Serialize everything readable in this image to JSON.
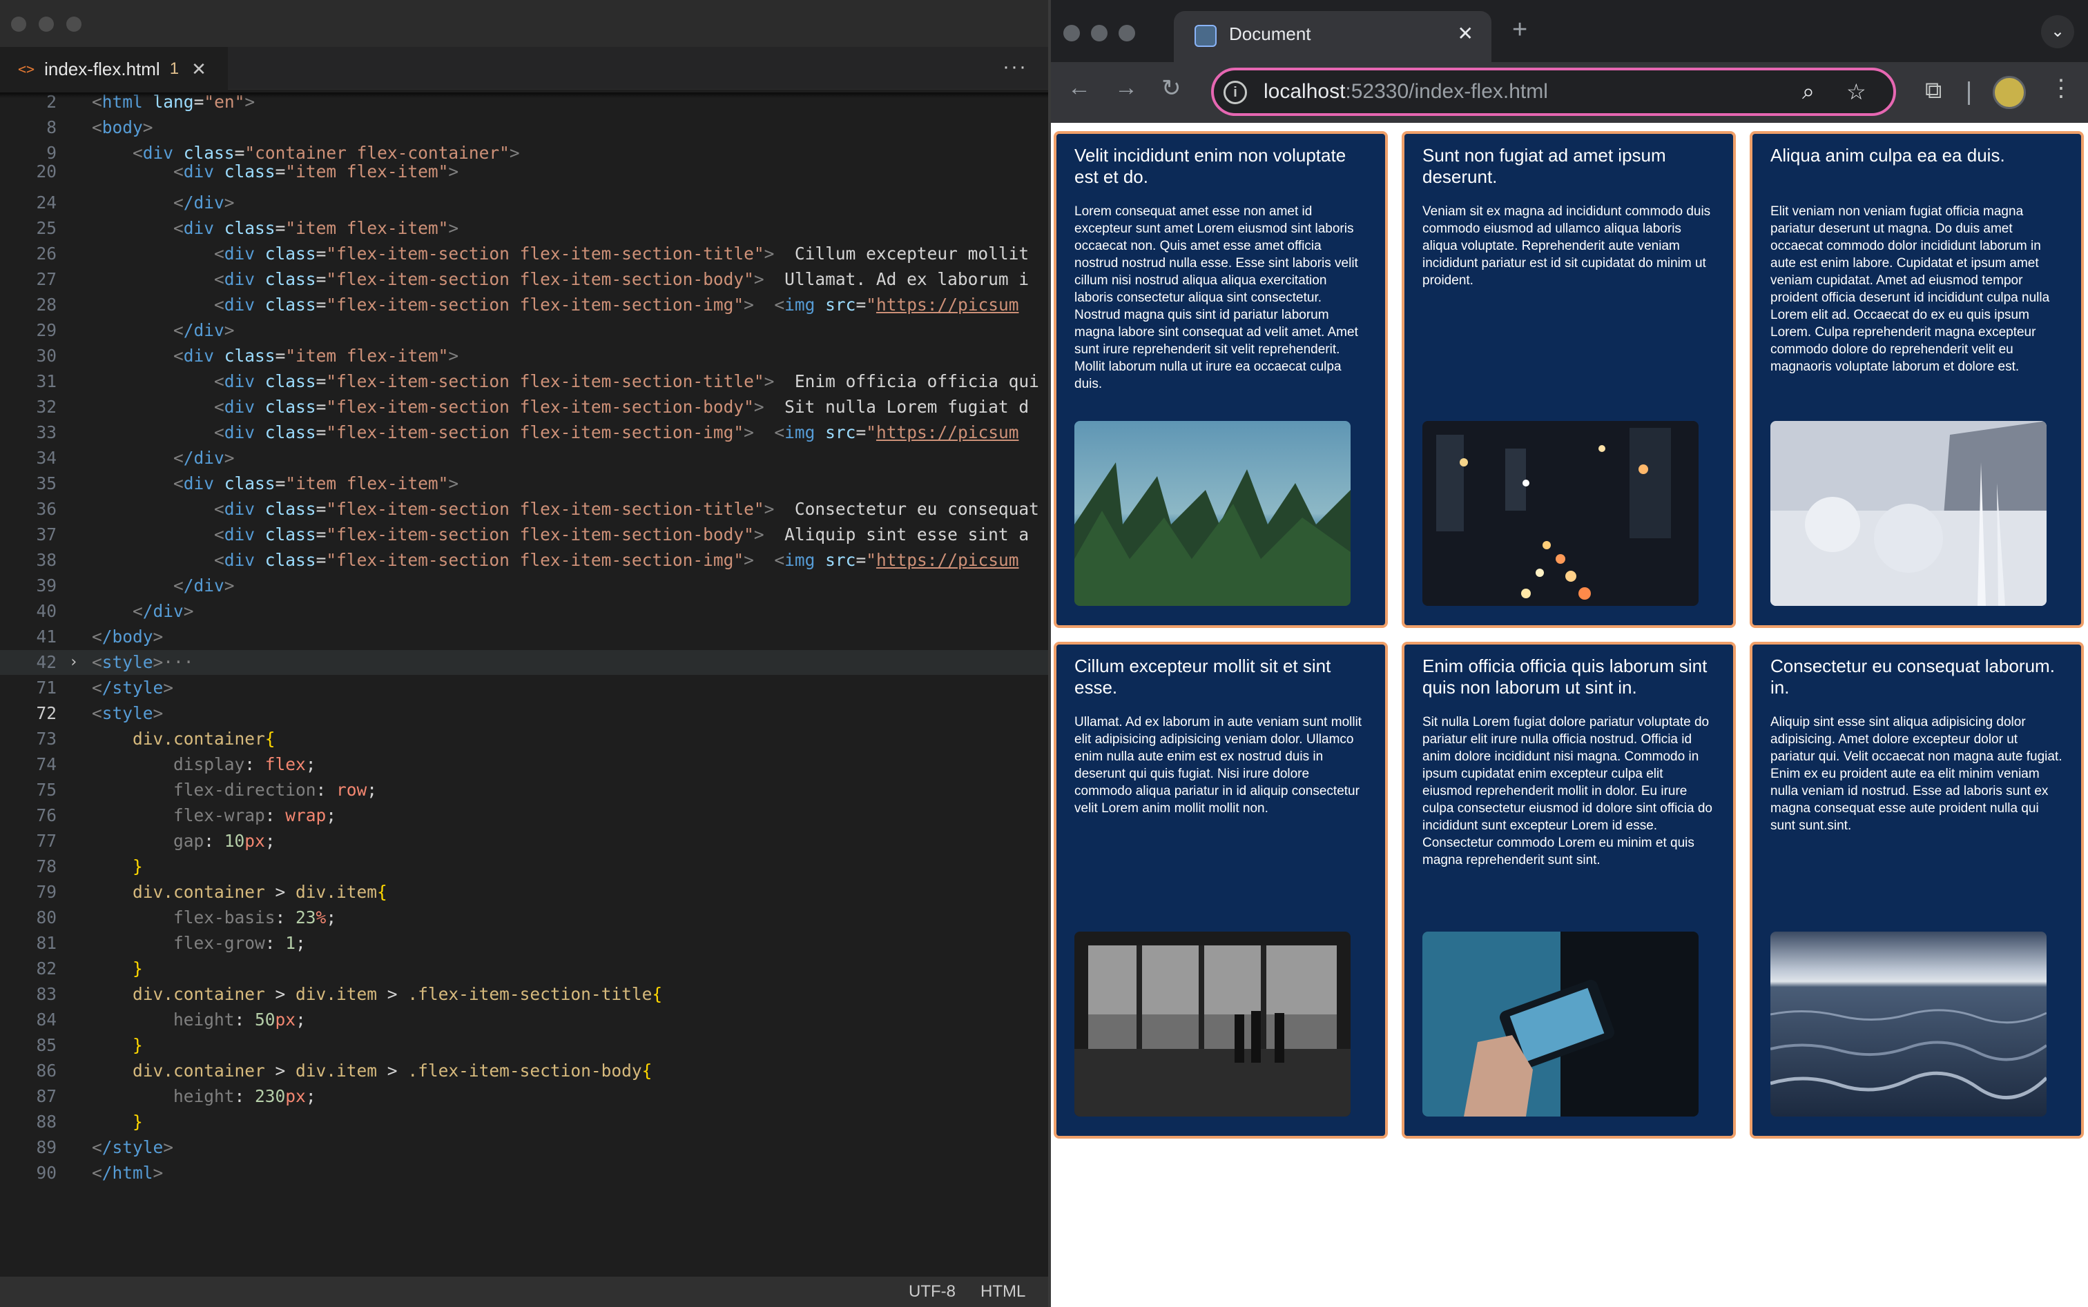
{
  "editor": {
    "tab": {
      "filename": "index-flex.html",
      "badge": "1"
    },
    "more_icon": "ellipsis-icon",
    "status": {
      "encoding": "UTF-8",
      "language": "HTML"
    },
    "lines": [
      {
        "n": "2",
        "text": "<html lang=\"en\">"
      },
      {
        "n": "8",
        "text": "<body>"
      },
      {
        "n": "9",
        "text": "<div class=\"container flex-container\">"
      },
      {
        "n": "20",
        "text": "<div class=\"item flex-item\">"
      },
      {
        "n": "24",
        "text": "</div>"
      },
      {
        "n": "25",
        "text": "<div class=\"item flex-item\">"
      },
      {
        "n": "26",
        "text": "<div class=\"flex-item-section flex-item-section-title\">  Cillum excepteur mollit"
      },
      {
        "n": "27",
        "text": "<div class=\"flex-item-section flex-item-section-body\">  Ullamat. Ad ex laborum i"
      },
      {
        "n": "28",
        "text": "<div class=\"flex-item-section flex-item-section-img\">  <img src=\"https://picsum"
      },
      {
        "n": "29",
        "text": "</div>"
      },
      {
        "n": "30",
        "text": "<div class=\"item flex-item\">"
      },
      {
        "n": "31",
        "text": "<div class=\"flex-item-section flex-item-section-title\">  Enim officia officia qui"
      },
      {
        "n": "32",
        "text": "<div class=\"flex-item-section flex-item-section-body\">  Sit nulla Lorem fugiat d"
      },
      {
        "n": "33",
        "text": "<div class=\"flex-item-section flex-item-section-img\">  <img src=\"https://picsum"
      },
      {
        "n": "34",
        "text": "</div>"
      },
      {
        "n": "35",
        "text": "<div class=\"item flex-item\">"
      },
      {
        "n": "36",
        "text": "<div class=\"flex-item-section flex-item-section-title\">  Consectetur eu consequat"
      },
      {
        "n": "37",
        "text": "<div class=\"flex-item-section flex-item-section-body\">  Aliquip sint esse sint a"
      },
      {
        "n": "38",
        "text": "<div class=\"flex-item-section flex-item-section-img\">  <img src=\"https://picsum"
      },
      {
        "n": "39",
        "text": "</div>"
      },
      {
        "n": "40",
        "text": "</div>"
      },
      {
        "n": "41",
        "text": "</body>"
      },
      {
        "n": "42",
        "text": "<style>···"
      },
      {
        "n": "71",
        "text": "</style>"
      },
      {
        "n": "72",
        "text": "<style>"
      },
      {
        "n": "73",
        "text": "div.container{"
      },
      {
        "n": "74",
        "text": "display: flex;"
      },
      {
        "n": "75",
        "text": "flex-direction: row;"
      },
      {
        "n": "76",
        "text": "flex-wrap: wrap;"
      },
      {
        "n": "77",
        "text": "gap: 10px;"
      },
      {
        "n": "78",
        "text": "}"
      },
      {
        "n": "79",
        "text": "div.container > div.item{"
      },
      {
        "n": "80",
        "text": "flex-basis: 23%;"
      },
      {
        "n": "81",
        "text": "flex-grow: 1;"
      },
      {
        "n": "82",
        "text": "}"
      },
      {
        "n": "83",
        "text": "div.container > div.item > .flex-item-section-title{"
      },
      {
        "n": "84",
        "text": "height: 50px;"
      },
      {
        "n": "85",
        "text": "}"
      },
      {
        "n": "86",
        "text": "div.container > div.item > .flex-item-section-body{"
      },
      {
        "n": "87",
        "text": "height: 230px;"
      },
      {
        "n": "88",
        "text": "}"
      },
      {
        "n": "89",
        "text": "</style>"
      },
      {
        "n": "90",
        "text": "</html>"
      }
    ]
  },
  "browser": {
    "tab_title": "Document",
    "url_host": "localhost",
    "url_rest": ":52330/index-flex.html",
    "icons": [
      "back-icon",
      "forward-icon",
      "reload-icon",
      "site-info-icon",
      "zoom-icon",
      "bookmark-star-icon",
      "extensions-icon",
      "profile-avatar",
      "menu-icon",
      "tab-search-icon",
      "new-tab-icon"
    ],
    "cards": [
      {
        "title": "Velit incididunt enim non voluptate est et do.",
        "body": "Lorem consequat amet esse non amet id excepteur sunt amet Lorem eiusmod sint laboris occaecat non. Quis amet esse amet officia nostrud nostrud nulla esse. Esse sint laboris velit cillum nisi nostrud aliqua aliqua exercitation laboris consectetur aliqua sint consectetur. Nostrud magna quis sint id pariatur laborum magna labore sint consequat ad velit amet. Amet sunt irure reprehenderit sit velit reprehenderit. Mollit laborum nulla ut irure ea occaecat culpa duis.",
        "image": "coastal-forest-photo"
      },
      {
        "title": "Sunt non fugiat ad amet ipsum deserunt.",
        "body": "Veniam sit ex magna ad incididunt commodo duis commodo eiusmod ad ullamco aliqua laboris aliqua voluptate. Reprehenderit aute veniam incididunt pariatur est id sit cupidatat do minim ut proident.",
        "image": "city-night-traffic-photo"
      },
      {
        "title": "Aliqua anim culpa ea ea duis.",
        "body": "Elit veniam non veniam fugiat officia magna pariatur deserunt ut magna. Do duis amet occaecat commodo dolor incididunt laborum in aute est enim labore. Cupidatat et ipsum amet veniam cupidatat. Amet ad eiusmod tempor proident officia deserunt id incididunt culpa nulla Lorem elit ad. Occaecat do ex eu quis ipsum Lorem. Culpa reprehenderit magna excepteur commodo dolore do reprehenderit velit eu magnaoris voluptate laborum et dolore est.",
        "image": "frosted-plants-photo"
      },
      {
        "title": "Cillum excepteur mollit sit et sint esse.",
        "body": "Ullamat. Ad ex laborum in aute veniam sunt mollit elit adipisicing adipisicing veniam dolor. Ullamco enim nulla aute enim est ex nostrud duis in deserunt qui quis fugiat. Nisi irure dolore commodo aliqua pariatur in id aliquip consectetur velit Lorem anim mollit mollit non.",
        "image": "observation-deck-photo"
      },
      {
        "title": "Enim officia officia quis laborum sint quis non laborum ut sint in.",
        "body": "Sit nulla Lorem fugiat dolore pariatur voluptate do pariatur elit irure nulla officia nostrud. Officia id anim dolore incididunt nisi magna. Commodo in ipsum cupidatat enim excepteur culpa elit eiusmod reprehenderit mollit in dolor. Eu irure culpa consectetur eiusmod id dolore sint officia do incididunt sunt excepteur Lorem id esse. Consectetur commodo Lorem eu minim et quis magna reprehenderit sunt sint.",
        "image": "hand-holding-phone-photo"
      },
      {
        "title": "Consectetur eu consequat laborum. in.",
        "body": "Aliquip sint esse sint aliqua adipisicing dolor adipisicing. Amet dolore excepteur dolor ut pariatur qui. Velit occaecat non magna aute fugiat. Enim ex eu proident aute ea elit minim veniam nulla veniam id nostrud. Esse ad laboris sunt ex magna consequat esse aute proident nulla qui sunt sunt.sint.",
        "image": "ocean-waves-photo"
      }
    ]
  }
}
